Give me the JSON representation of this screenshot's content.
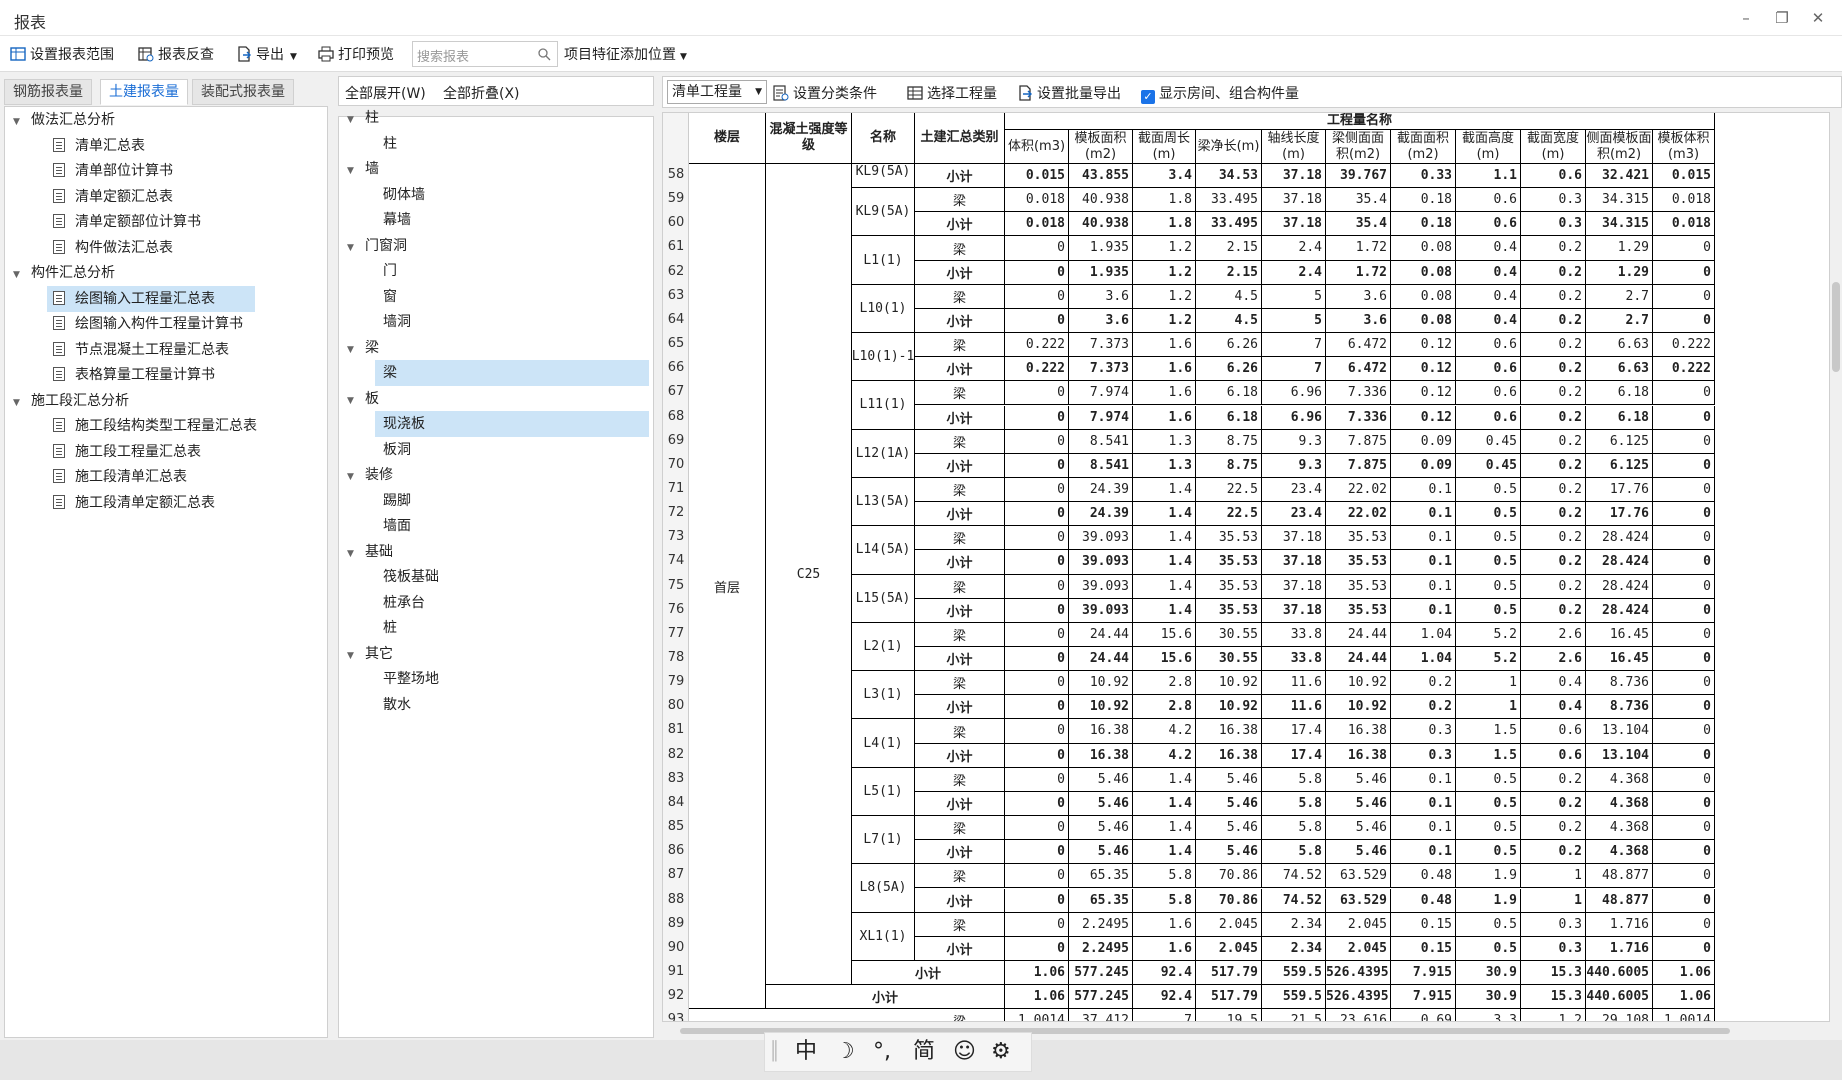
{
  "window": {
    "title": "报表"
  },
  "toolbar": {
    "set_range": "设置报表范围",
    "recheck": "报表反查",
    "export": "导出",
    "print_preview": "打印预览",
    "search_placeholder": "搜索报表",
    "add_position": "项目特征添加位置"
  },
  "left_tabs": [
    "钢筋报表量",
    "土建报表量",
    "装配式报表量"
  ],
  "left_tree": [
    {
      "label": "做法汇总分析",
      "level": 0
    },
    {
      "label": "清单汇总表",
      "level": 1
    },
    {
      "label": "清单部位计算书",
      "level": 1
    },
    {
      "label": "清单定额汇总表",
      "level": 1
    },
    {
      "label": "清单定额部位计算书",
      "level": 1
    },
    {
      "label": "构件做法汇总表",
      "level": 1
    },
    {
      "label": "构件汇总分析",
      "level": 0
    },
    {
      "label": "绘图输入工程量汇总表",
      "level": 1,
      "selected": true
    },
    {
      "label": "绘图输入构件工程量计算书",
      "level": 1
    },
    {
      "label": "节点混凝土工程量汇总表",
      "level": 1
    },
    {
      "label": "表格算量工程量计算书",
      "level": 1
    },
    {
      "label": "施工段汇总分析",
      "level": 0
    },
    {
      "label": "施工段结构类型工程量汇总表",
      "level": 1
    },
    {
      "label": "施工段工程量汇总表",
      "level": 1
    },
    {
      "label": "施工段清单汇总表",
      "level": 1
    },
    {
      "label": "施工段清单定额汇总表",
      "level": 1
    }
  ],
  "mid_header": {
    "expand_all": "全部展开(W)",
    "collapse_all": "全部折叠(X)"
  },
  "mid_tree": [
    {
      "label": "柱",
      "level": 0
    },
    {
      "label": "柱",
      "level": 1
    },
    {
      "label": "墙",
      "level": 0
    },
    {
      "label": "砌体墙",
      "level": 1
    },
    {
      "label": "幕墙",
      "level": 1
    },
    {
      "label": "门窗洞",
      "level": 0
    },
    {
      "label": "门",
      "level": 1
    },
    {
      "label": "窗",
      "level": 1
    },
    {
      "label": "墙洞",
      "level": 1
    },
    {
      "label": "梁",
      "level": 0
    },
    {
      "label": "梁",
      "level": 1,
      "selected": true
    },
    {
      "label": "板",
      "level": 0
    },
    {
      "label": "现浇板",
      "level": 1,
      "selected": true
    },
    {
      "label": "板洞",
      "level": 1
    },
    {
      "label": "装修",
      "level": 0
    },
    {
      "label": "踢脚",
      "level": 1
    },
    {
      "label": "墙面",
      "level": 1
    },
    {
      "label": "基础",
      "level": 0
    },
    {
      "label": "筏板基础",
      "level": 1
    },
    {
      "label": "桩承台",
      "level": 1
    },
    {
      "label": "桩",
      "level": 1
    },
    {
      "label": "其它",
      "level": 0
    },
    {
      "label": "平整场地",
      "level": 1
    },
    {
      "label": "散水",
      "level": 1
    }
  ],
  "right_header": {
    "select_value": "清单工程量",
    "set_category": "设置分类条件",
    "select_qty": "选择工程量",
    "set_batch_export": "设置批量导出",
    "show_rooms": "显示房间、组合构件量"
  },
  "table": {
    "header": {
      "floor": "楼层",
      "concrete": "混凝土强度等级",
      "name": "名称",
      "category": "土建汇总类别",
      "group": "工程量名称",
      "columns": [
        "体积(m3)",
        "模板面积(m2)",
        "截面周长(m)",
        "梁净长(m)",
        "轴线长度(m)",
        "梁侧面面积(m2)",
        "截面面积(m2)",
        "截面高度(m)",
        "截面宽度(m)",
        "侧面模板面积(m2)",
        "模板体积(m3)"
      ]
    },
    "floor": "首层",
    "concrete": "C25",
    "partial_name": "KL9(5A)",
    "first_row": {
      "num": "58",
      "type": "小计",
      "values": [
        "0.015",
        "43.855",
        "3.4",
        "34.53",
        "37.18",
        "39.767",
        "0.33",
        "1.1",
        "0.6",
        "32.421",
        "0.015"
      ]
    },
    "groups": [
      {
        "name": "KL9(5A)",
        "beam": [
          "0.018",
          "40.938",
          "1.8",
          "33.495",
          "37.18",
          "35.4",
          "0.18",
          "0.6",
          "0.3",
          "34.315",
          "0.018"
        ],
        "sub": [
          "0.018",
          "40.938",
          "1.8",
          "33.495",
          "37.18",
          "35.4",
          "0.18",
          "0.6",
          "0.3",
          "34.315",
          "0.018"
        ]
      },
      {
        "name": "L1(1)",
        "beam": [
          "0",
          "1.935",
          "1.2",
          "2.15",
          "2.4",
          "1.72",
          "0.08",
          "0.4",
          "0.2",
          "1.29",
          "0"
        ],
        "sub": [
          "0",
          "1.935",
          "1.2",
          "2.15",
          "2.4",
          "1.72",
          "0.08",
          "0.4",
          "0.2",
          "1.29",
          "0"
        ]
      },
      {
        "name": "L10(1)",
        "beam": [
          "0",
          "3.6",
          "1.2",
          "4.5",
          "5",
          "3.6",
          "0.08",
          "0.4",
          "0.2",
          "2.7",
          "0"
        ],
        "sub": [
          "0",
          "3.6",
          "1.2",
          "4.5",
          "5",
          "3.6",
          "0.08",
          "0.4",
          "0.2",
          "2.7",
          "0"
        ]
      },
      {
        "name": "L10(1)-1",
        "beam": [
          "0.222",
          "7.373",
          "1.6",
          "6.26",
          "7",
          "6.472",
          "0.12",
          "0.6",
          "0.2",
          "6.63",
          "0.222"
        ],
        "sub": [
          "0.222",
          "7.373",
          "1.6",
          "6.26",
          "7",
          "6.472",
          "0.12",
          "0.6",
          "0.2",
          "6.63",
          "0.222"
        ]
      },
      {
        "name": "L11(1)",
        "beam": [
          "0",
          "7.974",
          "1.6",
          "6.18",
          "6.96",
          "7.336",
          "0.12",
          "0.6",
          "0.2",
          "6.18",
          "0"
        ],
        "sub": [
          "0",
          "7.974",
          "1.6",
          "6.18",
          "6.96",
          "7.336",
          "0.12",
          "0.6",
          "0.2",
          "6.18",
          "0"
        ]
      },
      {
        "name": "L12(1A)",
        "beam": [
          "0",
          "8.541",
          "1.3",
          "8.75",
          "9.3",
          "7.875",
          "0.09",
          "0.45",
          "0.2",
          "6.125",
          "0"
        ],
        "sub": [
          "0",
          "8.541",
          "1.3",
          "8.75",
          "9.3",
          "7.875",
          "0.09",
          "0.45",
          "0.2",
          "6.125",
          "0"
        ]
      },
      {
        "name": "L13(5A)",
        "beam": [
          "0",
          "24.39",
          "1.4",
          "22.5",
          "23.4",
          "22.02",
          "0.1",
          "0.5",
          "0.2",
          "17.76",
          "0"
        ],
        "sub": [
          "0",
          "24.39",
          "1.4",
          "22.5",
          "23.4",
          "22.02",
          "0.1",
          "0.5",
          "0.2",
          "17.76",
          "0"
        ]
      },
      {
        "name": "L14(5A)",
        "beam": [
          "0",
          "39.093",
          "1.4",
          "35.53",
          "37.18",
          "35.53",
          "0.1",
          "0.5",
          "0.2",
          "28.424",
          "0"
        ],
        "sub": [
          "0",
          "39.093",
          "1.4",
          "35.53",
          "37.18",
          "35.53",
          "0.1",
          "0.5",
          "0.2",
          "28.424",
          "0"
        ]
      },
      {
        "name": "L15(5A)",
        "beam": [
          "0",
          "39.093",
          "1.4",
          "35.53",
          "37.18",
          "35.53",
          "0.1",
          "0.5",
          "0.2",
          "28.424",
          "0"
        ],
        "sub": [
          "0",
          "39.093",
          "1.4",
          "35.53",
          "37.18",
          "35.53",
          "0.1",
          "0.5",
          "0.2",
          "28.424",
          "0"
        ]
      },
      {
        "name": "L2(1)",
        "beam": [
          "0",
          "24.44",
          "15.6",
          "30.55",
          "33.8",
          "24.44",
          "1.04",
          "5.2",
          "2.6",
          "16.45",
          "0"
        ],
        "sub": [
          "0",
          "24.44",
          "15.6",
          "30.55",
          "33.8",
          "24.44",
          "1.04",
          "5.2",
          "2.6",
          "16.45",
          "0"
        ]
      },
      {
        "name": "L3(1)",
        "beam": [
          "0",
          "10.92",
          "2.8",
          "10.92",
          "11.6",
          "10.92",
          "0.2",
          "1",
          "0.4",
          "8.736",
          "0"
        ],
        "sub": [
          "0",
          "10.92",
          "2.8",
          "10.92",
          "11.6",
          "10.92",
          "0.2",
          "1",
          "0.4",
          "8.736",
          "0"
        ]
      },
      {
        "name": "L4(1)",
        "beam": [
          "0",
          "16.38",
          "4.2",
          "16.38",
          "17.4",
          "16.38",
          "0.3",
          "1.5",
          "0.6",
          "13.104",
          "0"
        ],
        "sub": [
          "0",
          "16.38",
          "4.2",
          "16.38",
          "17.4",
          "16.38",
          "0.3",
          "1.5",
          "0.6",
          "13.104",
          "0"
        ]
      },
      {
        "name": "L5(1)",
        "beam": [
          "0",
          "5.46",
          "1.4",
          "5.46",
          "5.8",
          "5.46",
          "0.1",
          "0.5",
          "0.2",
          "4.368",
          "0"
        ],
        "sub": [
          "0",
          "5.46",
          "1.4",
          "5.46",
          "5.8",
          "5.46",
          "0.1",
          "0.5",
          "0.2",
          "4.368",
          "0"
        ]
      },
      {
        "name": "L7(1)",
        "beam": [
          "0",
          "5.46",
          "1.4",
          "5.46",
          "5.8",
          "5.46",
          "0.1",
          "0.5",
          "0.2",
          "4.368",
          "0"
        ],
        "sub": [
          "0",
          "5.46",
          "1.4",
          "5.46",
          "5.8",
          "5.46",
          "0.1",
          "0.5",
          "0.2",
          "4.368",
          "0"
        ]
      },
      {
        "name": "L8(5A)",
        "beam": [
          "0",
          "65.35",
          "5.8",
          "70.86",
          "74.52",
          "63.529",
          "0.48",
          "1.9",
          "1",
          "48.877",
          "0"
        ],
        "sub": [
          "0",
          "65.35",
          "5.8",
          "70.86",
          "74.52",
          "63.529",
          "0.48",
          "1.9",
          "1",
          "48.877",
          "0"
        ]
      },
      {
        "name": "XL1(1)",
        "beam": [
          "0",
          "2.2495",
          "1.6",
          "2.045",
          "2.34",
          "2.045",
          "0.15",
          "0.5",
          "0.3",
          "1.716",
          "0"
        ],
        "sub": [
          "0",
          "2.2495",
          "1.6",
          "2.045",
          "2.34",
          "2.045",
          "0.15",
          "0.5",
          "0.3",
          "1.716",
          "0"
        ]
      }
    ],
    "beam_label": "梁",
    "subtotal_label": "小计",
    "total91": [
      "1.06",
      "577.245",
      "92.4",
      "517.79",
      "559.5",
      "526.4395",
      "7.915",
      "30.9",
      "15.3",
      "440.6005",
      "1.06"
    ],
    "total92": [
      "1.06",
      "577.245",
      "92.4",
      "517.79",
      "559.5",
      "526.4395",
      "7.915",
      "30.9",
      "15.3",
      "440.6005",
      "1.06"
    ],
    "last_partial": [
      "1.0014",
      "37.412",
      "7",
      "19.5",
      "21.5",
      "23.616",
      "0.69",
      "3.3",
      "1.2",
      "29.108",
      "1.0014"
    ],
    "row_start": 58
  },
  "ime": {
    "chinese": "中",
    "moon": "☽",
    "punct": "°,",
    "simplified": "简",
    "emoji": "☺",
    "settings": "⚙"
  }
}
